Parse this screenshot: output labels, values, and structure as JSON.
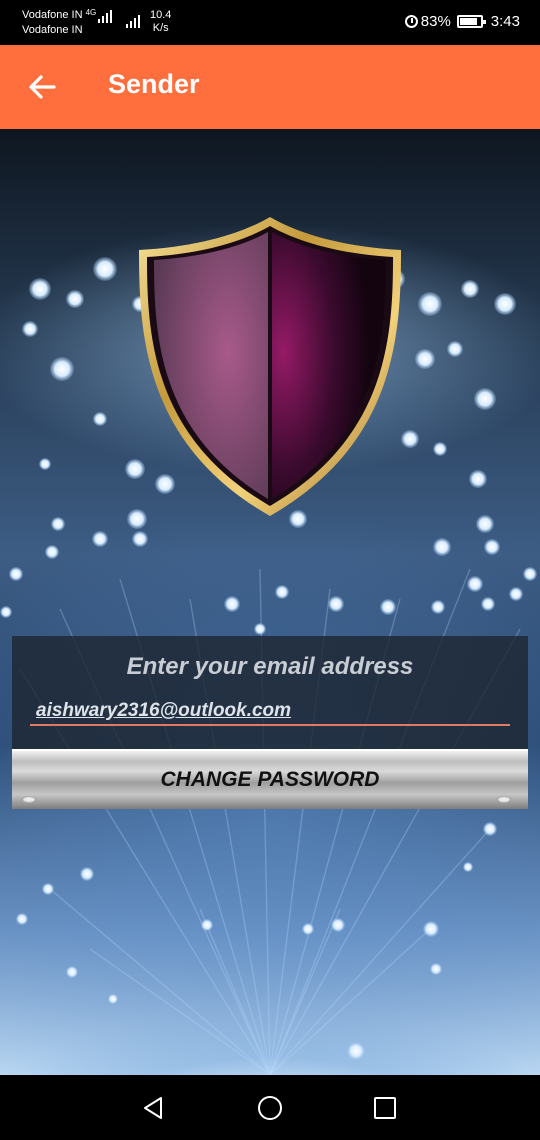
{
  "status_bar": {
    "carrier_1": "Vodafone IN",
    "carrier_1_network": "4G",
    "carrier_2": "Vodafone IN",
    "speed_value": "10.4",
    "speed_unit": "K/s",
    "battery_percent": "83%",
    "time": "3:43",
    "icons": [
      "signal-icon",
      "alarm-icon",
      "battery-icon"
    ]
  },
  "app_bar": {
    "title": "Sender",
    "back_icon": "arrow-left-icon",
    "background_color": "#ff6f3d"
  },
  "hero": {
    "emblem_icon": "shield-icon"
  },
  "form": {
    "prompt": "Enter your email address",
    "email_value": "aishwary2316@outlook.com",
    "submit_label": "CHANGE PASSWORD",
    "underline_color": "#e07a62"
  },
  "nav_bar": {
    "icons": [
      "back-triangle-icon",
      "home-circle-icon",
      "recents-square-icon"
    ]
  }
}
